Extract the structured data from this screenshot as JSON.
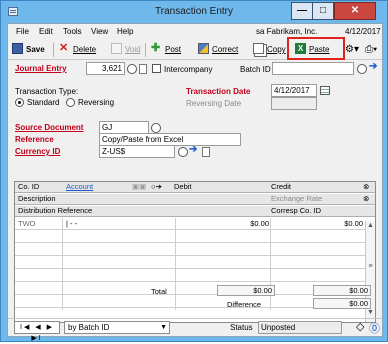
{
  "window": {
    "title": "Transaction Entry",
    "minimize": "—",
    "maximize": "□",
    "close": "✕"
  },
  "menu": {
    "items": [
      "File",
      "Edit",
      "Tools",
      "View",
      "Help"
    ],
    "company": "sa  Fabrikam, Inc.",
    "user_date": "4/12/2017"
  },
  "toolbar": {
    "save": "Save",
    "delete": "Delete",
    "void": "Void",
    "post": "Post",
    "correct": "Correct",
    "copy": "Copy",
    "paste": "Paste"
  },
  "header": {
    "journal_entry_label": "Journal Entry",
    "journal_entry_value": "3,621",
    "intercompany_label": "Intercompany",
    "batch_id_label": "Batch ID",
    "batch_id_value": "",
    "transaction_type_label": "Transaction Type:",
    "standard_label": "Standard",
    "reversing_label": "Reversing",
    "transaction_date_label": "Transaction Date",
    "transaction_date_value": "4/12/2017",
    "reversing_date_label": "Reversing Date",
    "reversing_date_value": ""
  },
  "source": {
    "source_document_label": "Source Document",
    "source_document_value": "GJ",
    "reference_label": "Reference",
    "reference_value": "Copy/Paste from Excel",
    "currency_id_label": "Currency ID",
    "currency_id_value": "Z-US$"
  },
  "grid": {
    "headers": {
      "co_id": "Co. ID",
      "account": "Account",
      "debit": "Debit",
      "credit": "Credit",
      "description": "Description",
      "exchange_rate": "Exchange Rate",
      "distribution_reference": "Distribution Reference",
      "corresp_co_id": "Corresp Co. ID"
    },
    "rows": [
      {
        "co_id": "TWO",
        "account": "|    -    -",
        "debit": "$0.00",
        "credit": "$0.00"
      }
    ],
    "total_label": "Total",
    "total_debit": "$0.00",
    "total_credit": "$0.00",
    "difference_label": "Difference",
    "difference_value": "$0.00"
  },
  "statusbar": {
    "nav_label": "I◀ ◀ ▶ ▶I",
    "sort_value": "by Batch ID",
    "status_label": "Status",
    "status_value": "Unposted"
  }
}
